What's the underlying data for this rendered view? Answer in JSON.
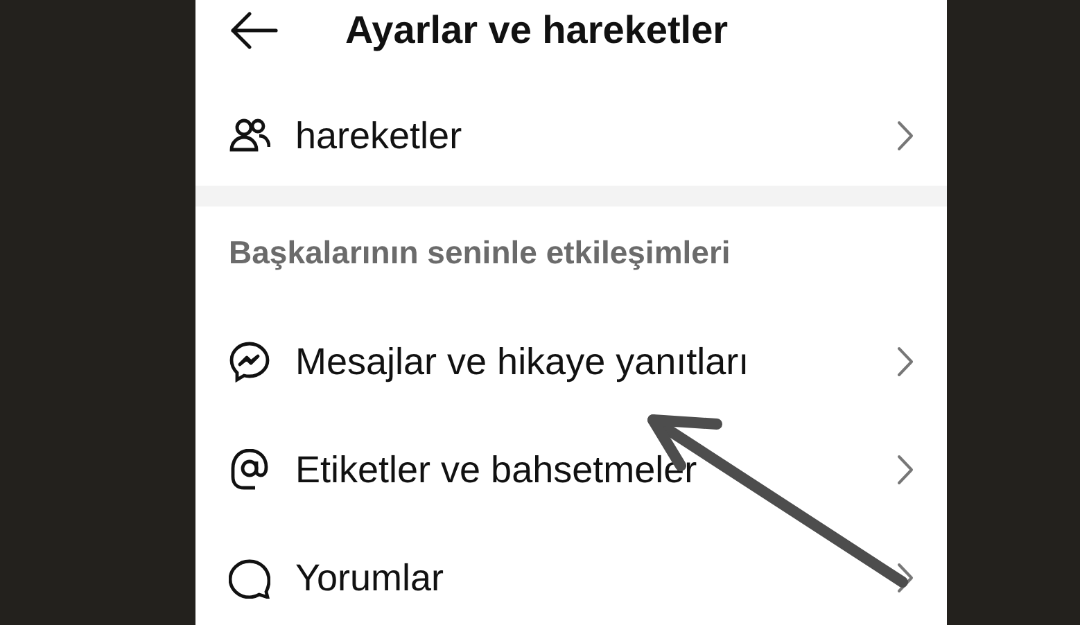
{
  "header": {
    "title": "Ayarlar ve hareketler"
  },
  "top_items": [
    {
      "kind": "people",
      "label_lines": [
        "hareketler"
      ]
    }
  ],
  "section": {
    "title": "Başkalarının seninle etkileşimleri",
    "items": [
      {
        "kind": "messenger",
        "label": "Mesajlar ve hikaye yanıtları"
      },
      {
        "kind": "at",
        "label": "Etiketler ve bahsetmeler"
      },
      {
        "kind": "comment",
        "label": "Yorumlar"
      }
    ]
  },
  "annotation_arrow": true
}
